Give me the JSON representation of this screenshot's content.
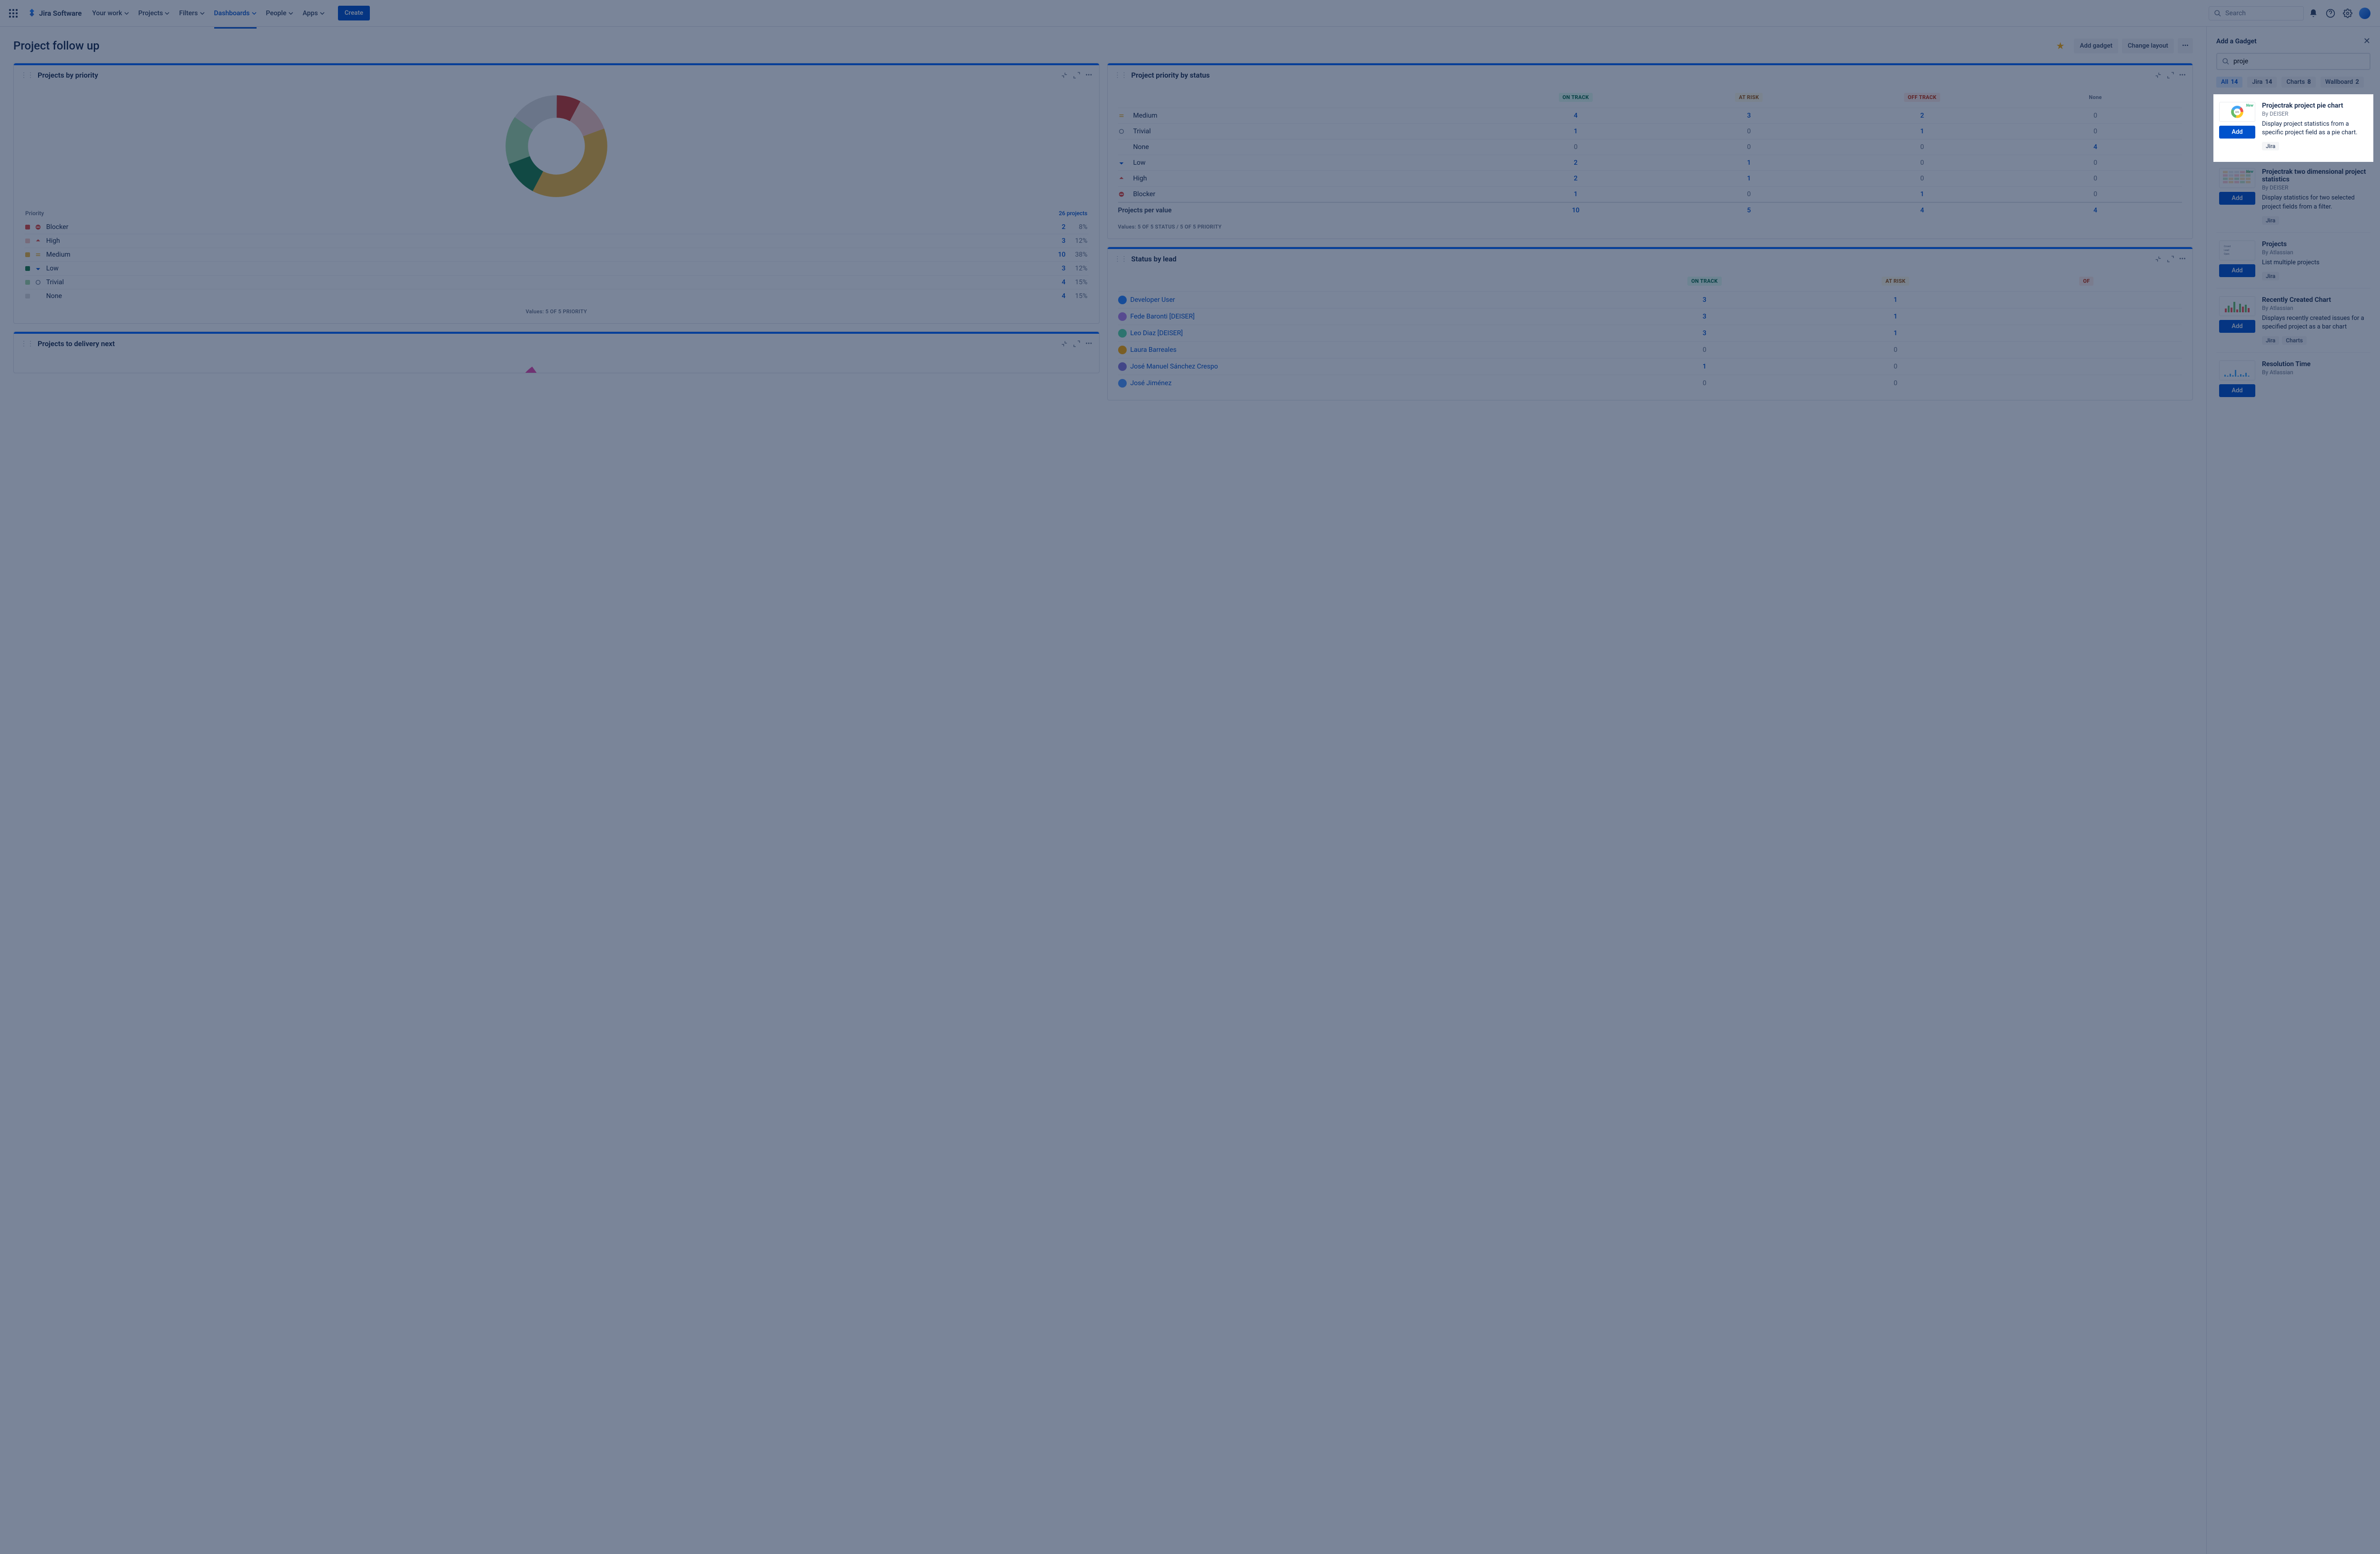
{
  "nav": {
    "logo": "Jira Software",
    "items": [
      "Your work",
      "Projects",
      "Filters",
      "Dashboards",
      "People",
      "Apps"
    ],
    "active_index": 3,
    "create": "Create",
    "search_placeholder": "Search"
  },
  "page": {
    "title": "Project follow up",
    "add_gadget": "Add gadget",
    "change_layout": "Change layout"
  },
  "priority_card": {
    "title": "Projects by priority",
    "legend_header": "Priority",
    "total_label": "26 projects",
    "rows": [
      {
        "label": "Blocker",
        "count": "2",
        "pct": "8%",
        "sw": "#e2483d",
        "ptype": "blocker"
      },
      {
        "label": "High",
        "count": "3",
        "pct": "12%",
        "sw": "#f8c6be",
        "ptype": "high"
      },
      {
        "label": "Medium",
        "count": "10",
        "pct": "38%",
        "sw": "#efb73e",
        "ptype": "medium"
      },
      {
        "label": "Low",
        "count": "3",
        "pct": "12%",
        "sw": "#1b7d46",
        "ptype": "low"
      },
      {
        "label": "Trivial",
        "count": "4",
        "pct": "15%",
        "sw": "#a3d9a5",
        "ptype": "trivial"
      },
      {
        "label": "None",
        "count": "4",
        "pct": "15%",
        "sw": "#dcdcdc",
        "ptype": "none"
      }
    ],
    "summary": "Values: 5 OF 5 PRIORITY"
  },
  "chart_data": {
    "type": "pie",
    "title": "Projects by priority",
    "categories": [
      "Blocker",
      "High",
      "Medium",
      "Low",
      "Trivial",
      "None"
    ],
    "values": [
      2,
      3,
      10,
      3,
      4,
      4
    ],
    "colors": [
      "#c9372c",
      "#f8c6be",
      "#efb73e",
      "#1b7d46",
      "#a3d9a5",
      "#dcdcdc"
    ],
    "total": 26,
    "inner_radius_pct": 58
  },
  "delivery_card": {
    "title": "Projects to delivery next"
  },
  "status_card": {
    "title": "Project priority by status",
    "heads": [
      "ON TRACK",
      "AT RISK",
      "OFF TRACK",
      "None"
    ],
    "rows": [
      {
        "label": "Medium",
        "ptype": "medium",
        "v": [
          "4",
          "3",
          "2",
          "0"
        ]
      },
      {
        "label": "Trivial",
        "ptype": "trivial",
        "v": [
          "1",
          "0",
          "1",
          "0"
        ]
      },
      {
        "label": "None",
        "ptype": "none",
        "v": [
          "0",
          "0",
          "0",
          "4"
        ]
      },
      {
        "label": "Low",
        "ptype": "low",
        "v": [
          "2",
          "1",
          "0",
          "0"
        ]
      },
      {
        "label": "High",
        "ptype": "high",
        "v": [
          "2",
          "1",
          "0",
          "0"
        ]
      },
      {
        "label": "Blocker",
        "ptype": "blocker",
        "v": [
          "1",
          "0",
          "1",
          "0"
        ]
      }
    ],
    "total_label": "Projects per value",
    "totals": [
      "10",
      "5",
      "4",
      "4"
    ],
    "summary": "Values: 5 OF 5 STATUS / 5 OF 5 PRIORITY"
  },
  "lead_card": {
    "title": "Status by lead",
    "heads": [
      "ON TRACK",
      "AT RISK",
      "OF"
    ],
    "rows": [
      {
        "label": "Developer User",
        "av": "#2684ff",
        "v": [
          "3",
          "1"
        ]
      },
      {
        "label": "Fede Baronti [DEISER]",
        "av": "#b37feb",
        "v": [
          "3",
          "1"
        ]
      },
      {
        "label": "Leo Diaz [DEISER]",
        "av": "#57d9a3",
        "v": [
          "3",
          "1"
        ]
      },
      {
        "label": "Laura Barreales",
        "av": "#ffab00",
        "v": [
          "0",
          "0"
        ]
      },
      {
        "label": "José Manuel Sánchez Crespo",
        "av": "#8777d9",
        "v": [
          "1",
          "0"
        ]
      },
      {
        "label": "José Jiménez",
        "av": "#4c9aff",
        "v": [
          "0",
          "0"
        ]
      }
    ]
  },
  "panel": {
    "title": "Add a Gadget",
    "search_value": "proje",
    "filters": [
      {
        "label": "All",
        "n": "14",
        "active": true
      },
      {
        "label": "Jira",
        "n": "14"
      },
      {
        "label": "Charts",
        "n": "8"
      },
      {
        "label": "Wallboard",
        "n": "2"
      }
    ],
    "add_label": "Add",
    "gadgets": [
      {
        "name": "Projectrak project pie chart",
        "by": "By DEISER",
        "desc": "Display project statistics from a specific project field as a pie chart.",
        "tags": [
          "Jira"
        ],
        "thumb": "donut",
        "new": true,
        "highlight": true
      },
      {
        "name": "Projectrak two dimensional project statistics",
        "by": "By DEISER",
        "desc": "Display statistics for two selected project fields from a filter.",
        "tags": [
          "Jira"
        ],
        "thumb": "grid",
        "new": true
      },
      {
        "name": "Projects",
        "by": "By Atlassian",
        "desc": "List multiple projects",
        "tags": [
          "Jira"
        ],
        "thumb": "list"
      },
      {
        "name": "Recently Created Chart",
        "by": "By Atlassian",
        "desc": "Displays recently created issues for a specified project as a bar chart",
        "tags": [
          "Jira",
          "Charts"
        ],
        "thumb": "bars"
      },
      {
        "name": "Resolution Time",
        "by": "By Atlassian",
        "desc": "",
        "tags": [],
        "thumb": "bars2"
      }
    ]
  }
}
